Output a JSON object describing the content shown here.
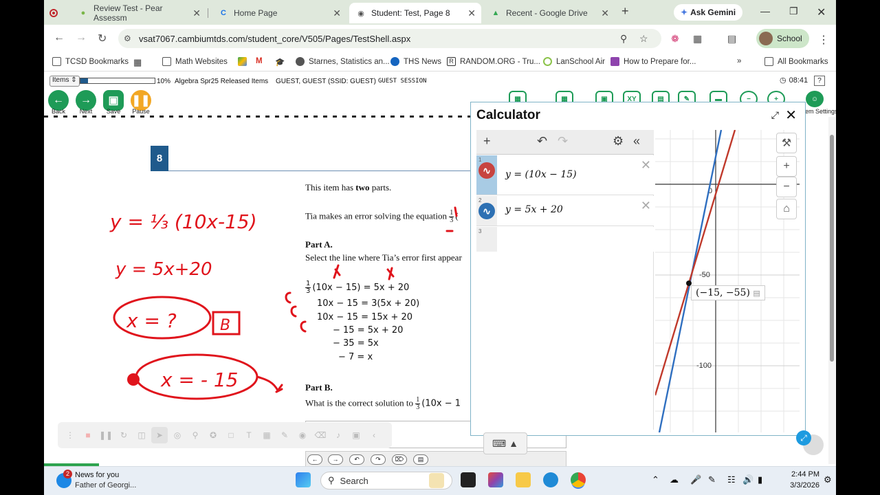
{
  "browser": {
    "tabs": [
      {
        "label": "Review Test - Pear Assessm"
      },
      {
        "label": "Home Page"
      },
      {
        "label": "Student: Test, Page 8"
      },
      {
        "label": "Recent - Google Drive"
      }
    ],
    "gemini": "Ask Gemini",
    "url": "vsat7067.cambiumtds.com/student_core/V505/Pages/TestShell.aspx",
    "profile": "School",
    "bookmarks": [
      "TCSD Bookmarks",
      "Math Websites",
      "Starnes, Statistics an...",
      "THS News",
      "RANDOM.ORG - Tru...",
      "LanSchool Air",
      "How to Prepare for...",
      "All Bookmarks"
    ]
  },
  "test": {
    "items_label": "Items",
    "progress_pct": 10,
    "progress_label": "10%",
    "test_name": "Algebra Spr25 Released Items",
    "student": "GUEST, GUEST (SSID: GUEST)",
    "session": "GUEST SESSION",
    "time": "08:41",
    "help": "?",
    "nav": {
      "back": "Back",
      "next": "Next",
      "save": "Save",
      "pause": "Pause"
    },
    "item_settings": "Item Settings",
    "question_number": "8"
  },
  "question": {
    "intro_pre": "This item has ",
    "intro_bold": "two",
    "intro_post": " parts.",
    "prompt": "Tia makes an error solving the equation",
    "part_a_title": "Part A.",
    "part_a_text": "Select the line where Tia’s error first appear",
    "steps": [
      "(10x − 15) = 5x + 20",
      "10x − 15 = 3(5x + 20)",
      "10x − 15 = 15x + 20",
      "− 15 = 5x + 20",
      "− 35 = 5x",
      "− 7 = x"
    ],
    "frac_n": "1",
    "frac_d": "3",
    "part_b_title": "Part B.",
    "part_b_text": "What is the correct solution to",
    "part_b_tail": "(10x − 1"
  },
  "calculator": {
    "title": "Calculator",
    "expressions": [
      {
        "index": "1",
        "text": "y = (10x − 15)"
      },
      {
        "index": "2",
        "text": "y = 5x + 20"
      },
      {
        "index": "3",
        "text": ""
      }
    ],
    "axis_labels": {
      "x0": "0",
      "y50": "-50",
      "y100": "-100"
    },
    "point": "(−15, −55)"
  },
  "handwriting": [
    "y = 1/3 (10x-15)",
    "y = 5x+20",
    "x = ?",
    "B",
    "x = -15"
  ],
  "taskbar": {
    "news_badge": "2",
    "news_title": "News for you",
    "news_sub": "Father of Georgi...",
    "search": "Search",
    "time": "2:44 PM",
    "date": "3/3/2026"
  },
  "colors": {
    "accent_green": "#1e9b57",
    "question_blue": "#1f5a8c",
    "graph_red": "#c0392b",
    "graph_blue": "#2f6fc0",
    "ink_red": "#e0141c"
  }
}
